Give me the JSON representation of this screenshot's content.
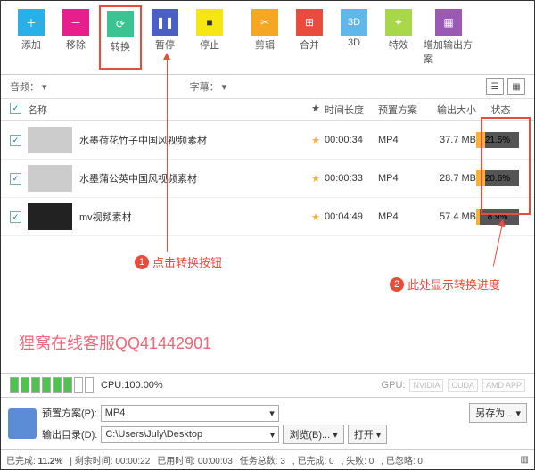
{
  "toolbar": {
    "add": "添加",
    "remove": "移除",
    "convert": "转换",
    "pause": "暂停",
    "stop": "停止",
    "cut": "剪辑",
    "merge": "合并",
    "threeD": "3D",
    "effects": "特效",
    "addOutput": "增加输出方案"
  },
  "options": {
    "audio": "音频：",
    "subtitle": "字幕："
  },
  "columns": {
    "name": "名称",
    "star": "★",
    "duration": "时间长度",
    "preset": "预置方案",
    "size": "输出大小",
    "status": "状态"
  },
  "rows": [
    {
      "name": "水墨荷花竹子中国风视频素材",
      "duration": "00:00:34",
      "preset": "MP4",
      "size": "37.7 MB",
      "progress": "21.5%",
      "pct": 21.5
    },
    {
      "name": "水墨蒲公英中国风视频素材",
      "duration": "00:00:33",
      "preset": "MP4",
      "size": "28.7 MB",
      "progress": "20.6%",
      "pct": 20.6
    },
    {
      "name": "mv视频素材",
      "duration": "00:04:49",
      "preset": "MP4",
      "size": "57.4 MB",
      "progress": "8.9%",
      "pct": 8.9
    }
  ],
  "annotations": {
    "note1": "点击转换按钮",
    "note2": "此处显示转换进度"
  },
  "watermark": "狸窝在线客服QQ41442901",
  "cpu": {
    "label": "CPU:100.00%"
  },
  "gpu": {
    "label": "GPU:",
    "tags": [
      "NVIDIA",
      "CUDA",
      "AMD APP"
    ]
  },
  "settings": {
    "presetLabel": "预置方案(P):",
    "presetValue": "MP4",
    "outputLabel": "输出目录(D):",
    "outputValue": "C:\\Users\\July\\Desktop",
    "browse": "浏览(B)...",
    "open": "打开",
    "saveAs": "另存为..."
  },
  "status": {
    "done": "已完成:",
    "pct": "11.2%",
    "remain": "剩余时间:",
    "remainVal": "00:00:22",
    "elapsed": "已用时间:",
    "elapsedVal": "00:00:03",
    "tasks": "任务总数:",
    "tasksVal": "3",
    "doneCount": "已完成:",
    "doneVal": "0",
    "fail": "失败:",
    "failVal": "0",
    "ignore": "已忽略:",
    "ignoreVal": "0"
  }
}
